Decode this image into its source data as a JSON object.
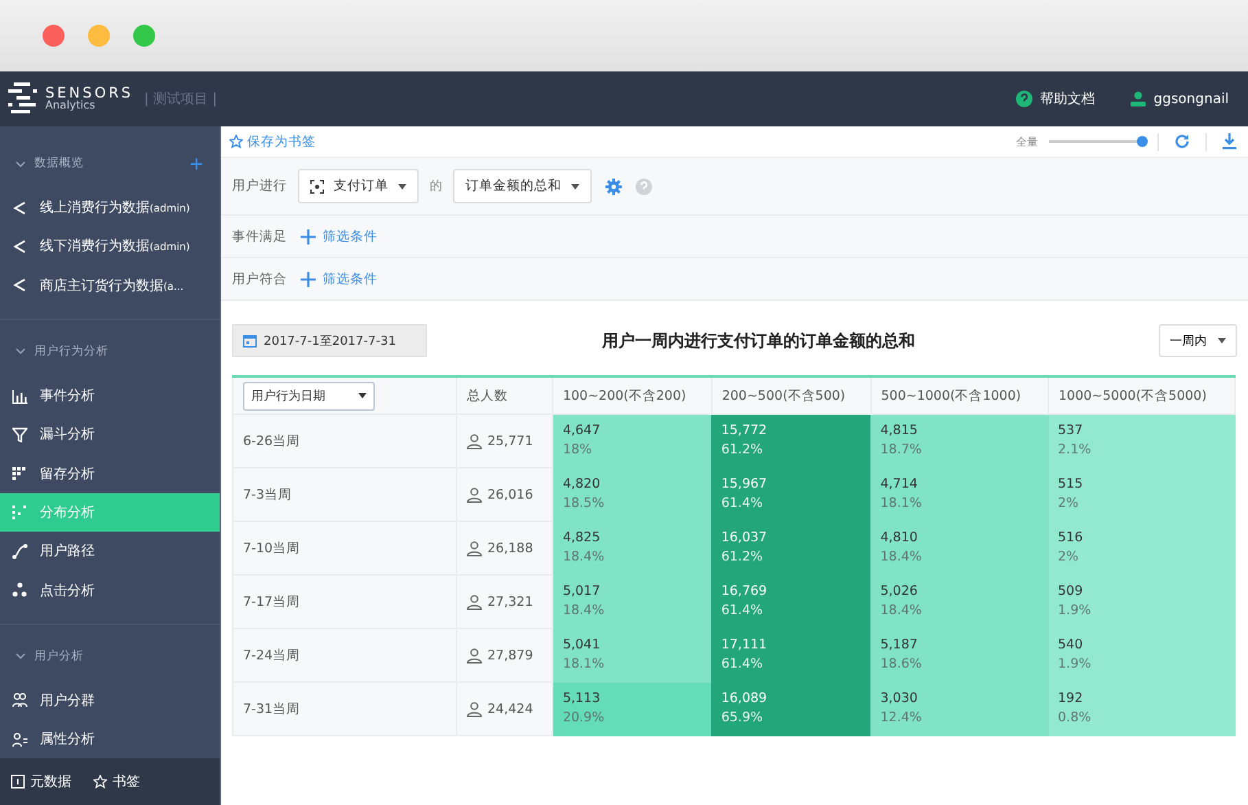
{
  "topbar": {
    "logo_main": "SENSORS",
    "logo_sub": "Analytics",
    "project": "| 测试项目 |",
    "help": "帮助文档",
    "user": "ggsongnail"
  },
  "sidebar": {
    "sections": [
      {
        "title": "数据概览",
        "expanded": true,
        "add": "+",
        "items": [
          {
            "label": "线上消费行为数据",
            "tag": "(admin)",
            "selected": false
          },
          {
            "label": "线下消费行为数据",
            "tag": "(admin)",
            "selected": false
          },
          {
            "label": "商店主订货行为数据",
            "tag": "(a...",
            "selected": false
          }
        ]
      },
      {
        "title": "用户行为分析",
        "expanded": true,
        "items": [
          {
            "label": "事件分析",
            "selected": false
          },
          {
            "label": "漏斗分析",
            "selected": false
          },
          {
            "label": "留存分析",
            "selected": false
          },
          {
            "label": "分布分析",
            "selected": true
          },
          {
            "label": "用户路径",
            "selected": false
          },
          {
            "label": "点击分析",
            "selected": false
          }
        ]
      },
      {
        "title": "用户分析",
        "expanded": true,
        "items": [
          {
            "label": "用户分群",
            "selected": false
          },
          {
            "label": "属性分析",
            "selected": false
          }
        ]
      }
    ],
    "footer": [
      "元数据",
      "书签"
    ]
  },
  "toolbar": {
    "bookmark": "保存为书签",
    "scale_label": "全量",
    "scale": {
      "level": 1.0
    }
  },
  "query": {
    "rows": [
      {
        "label": "用户进行",
        "event": "支付订单",
        "joiner": "的",
        "metric": "订单金额的总和"
      },
      {
        "label": "事件满足",
        "add": "筛选条件"
      },
      {
        "label": "用户符合",
        "add": "筛选条件"
      }
    ]
  },
  "report": {
    "date_range": "2017-7-1至2017-7-31",
    "title": "用户一周内进行支付订单的订单金额的总和",
    "period": "一周内",
    "table": {
      "columns": [
        "用户行为日期",
        "总人数",
        "100~200(不含200)",
        "200~500(不含500)",
        "500~1000(不含1000)",
        "1000~5000(不含5000)"
      ],
      "rows": [
        {
          "cells": [
            {
              "kind": "week",
              "text": "6-26当周"
            },
            {
              "kind": "total",
              "text": "25,771"
            },
            {
              "kind": "value",
              "count": "4,647",
              "pct": "18%",
              "color": "#7fe3c4"
            },
            {
              "kind": "value",
              "count": "15,772",
              "pct": "61.2%",
              "color": "#22a67a"
            },
            {
              "kind": "value",
              "count": "4,815",
              "pct": "18.7%",
              "color": "#7fe3c4"
            },
            {
              "kind": "value",
              "count": "537",
              "pct": "2.1%",
              "color": "#93e9cd"
            }
          ]
        },
        {
          "cells": [
            {
              "kind": "week",
              "text": "7-3当周"
            },
            {
              "kind": "total",
              "text": "26,016"
            },
            {
              "kind": "value",
              "count": "4,820",
              "pct": "18.5%",
              "color": "#7fe3c4"
            },
            {
              "kind": "value",
              "count": "15,967",
              "pct": "61.4%",
              "color": "#22a67a"
            },
            {
              "kind": "value",
              "count": "4,714",
              "pct": "18.1%",
              "color": "#7fe3c4"
            },
            {
              "kind": "value",
              "count": "515",
              "pct": "2%",
              "color": "#93e9cd"
            }
          ]
        },
        {
          "cells": [
            {
              "kind": "week",
              "text": "7-10当周"
            },
            {
              "kind": "total",
              "text": "26,188"
            },
            {
              "kind": "value",
              "count": "4,825",
              "pct": "18.4%",
              "color": "#7fe3c4"
            },
            {
              "kind": "value",
              "count": "16,037",
              "pct": "61.2%",
              "color": "#22a67a"
            },
            {
              "kind": "value",
              "count": "4,810",
              "pct": "18.4%",
              "color": "#7fe3c4"
            },
            {
              "kind": "value",
              "count": "516",
              "pct": "2%",
              "color": "#93e9cd"
            }
          ]
        },
        {
          "cells": [
            {
              "kind": "week",
              "text": "7-17当周"
            },
            {
              "kind": "total",
              "text": "27,321"
            },
            {
              "kind": "value",
              "count": "5,017",
              "pct": "18.4%",
              "color": "#7fe3c4"
            },
            {
              "kind": "value",
              "count": "16,769",
              "pct": "61.4%",
              "color": "#22a67a"
            },
            {
              "kind": "value",
              "count": "5,026",
              "pct": "18.4%",
              "color": "#7fe3c4"
            },
            {
              "kind": "value",
              "count": "509",
              "pct": "1.9%",
              "color": "#93e9cd"
            }
          ]
        },
        {
          "cells": [
            {
              "kind": "week",
              "text": "7-24当周"
            },
            {
              "kind": "total",
              "text": "27,879"
            },
            {
              "kind": "value",
              "count": "5,041",
              "pct": "18.1%",
              "color": "#7fe3c4"
            },
            {
              "kind": "value",
              "count": "17,111",
              "pct": "61.4%",
              "color": "#22a67a"
            },
            {
              "kind": "value",
              "count": "5,187",
              "pct": "18.6%",
              "color": "#7fe3c4"
            },
            {
              "kind": "value",
              "count": "540",
              "pct": "1.9%",
              "color": "#93e9cd"
            }
          ]
        },
        {
          "cells": [
            {
              "kind": "week",
              "text": "7-31当周"
            },
            {
              "kind": "total",
              "text": "24,424"
            },
            {
              "kind": "value",
              "count": "5,113",
              "pct": "20.9%",
              "color": "#64dcb5"
            },
            {
              "kind": "value",
              "count": "16,089",
              "pct": "65.9%",
              "color": "#22a67a"
            },
            {
              "kind": "value",
              "count": "3,030",
              "pct": "12.4%",
              "color": "#7fe3c4"
            },
            {
              "kind": "value",
              "count": "192",
              "pct": "0.8%",
              "color": "#93e9cd"
            }
          ]
        }
      ]
    }
  }
}
